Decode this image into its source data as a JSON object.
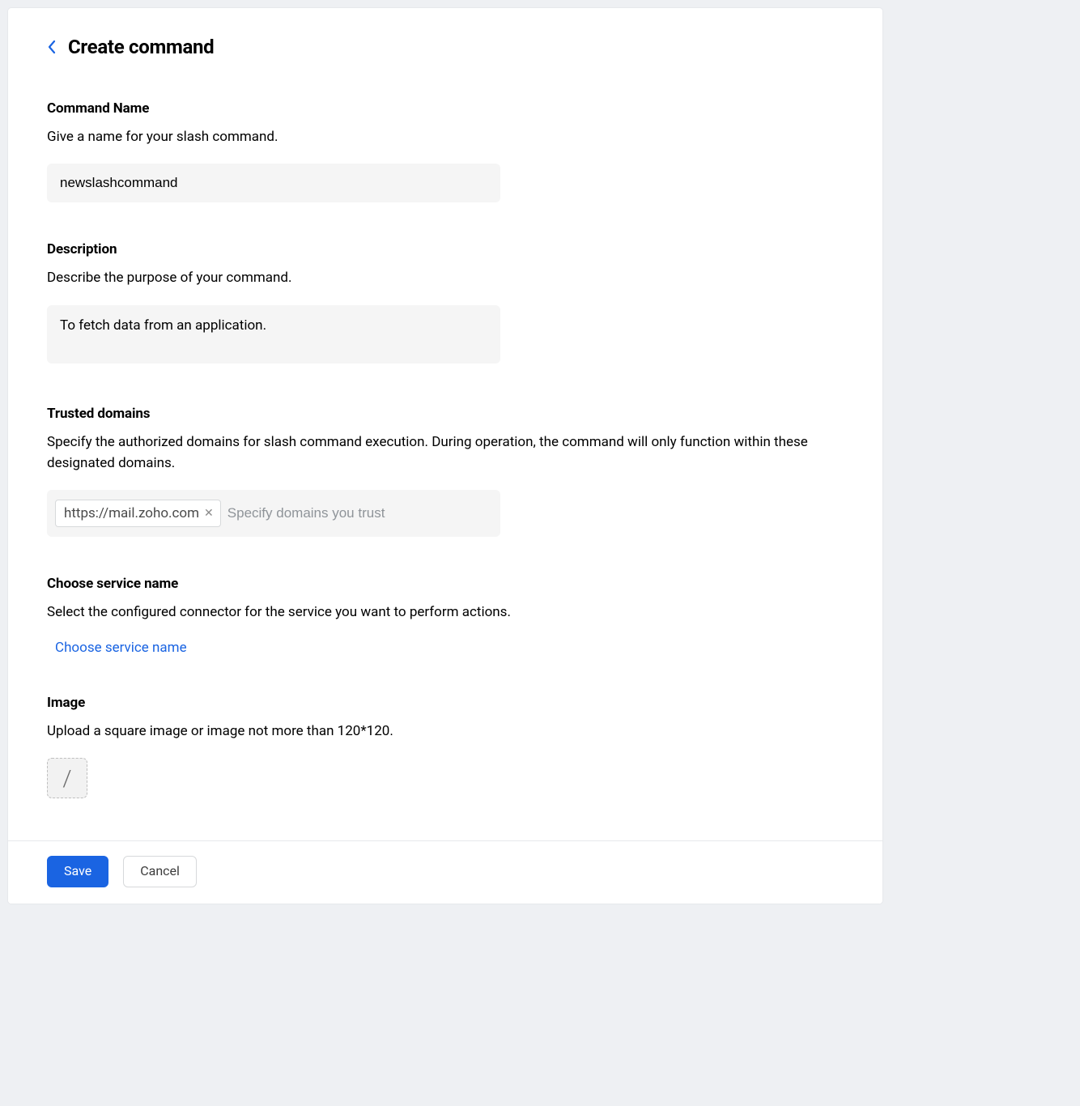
{
  "header": {
    "title": "Create command"
  },
  "fields": {
    "command_name": {
      "label": "Command Name",
      "help": "Give a name for your slash command.",
      "value": "newslashcommand"
    },
    "description": {
      "label": "Description",
      "help": "Describe the purpose of your command.",
      "value": "To fetch data from an application."
    },
    "trusted_domains": {
      "label": "Trusted domains",
      "help": "Specify the authorized domains for slash command execution. During operation, the command will only function within these designated domains.",
      "chip_value": "https://mail.zoho.com",
      "placeholder": "Specify domains you trust"
    },
    "service": {
      "label": "Choose service name",
      "help": "Select the configured connector for the service you want to perform actions.",
      "link_label": "Choose service name"
    },
    "image": {
      "label": "Image",
      "help": "Upload a square image or image not more than 120*120.",
      "placeholder_glyph": "/"
    }
  },
  "footer": {
    "save_label": "Save",
    "cancel_label": "Cancel"
  }
}
